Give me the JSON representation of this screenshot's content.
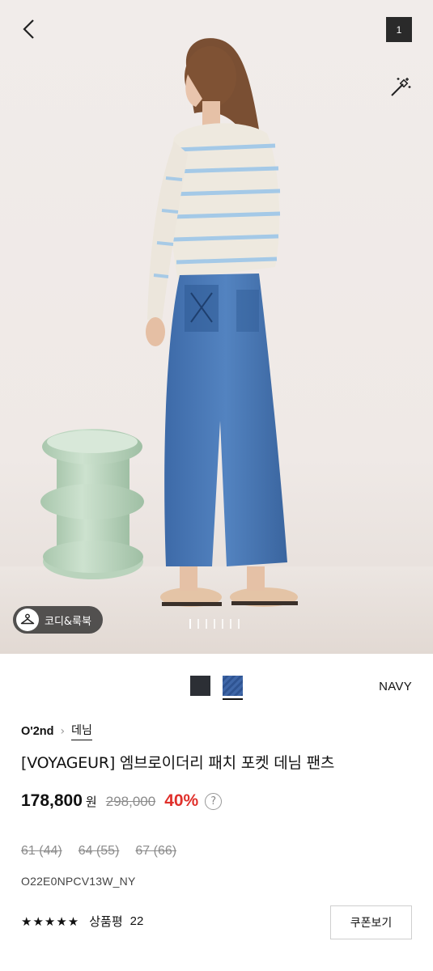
{
  "header": {
    "back_icon": "chevron-left-icon",
    "image_counter": "1",
    "magic_icon": "magic-wand-icon"
  },
  "gallery": {
    "lookbook_label": "코디&룩북",
    "lookbook_icon": "hanger-icon",
    "dot_count": 7,
    "active_dot": 0
  },
  "colors": {
    "swatches": [
      {
        "name": "dark-navy",
        "hex": "#2c2f35"
      },
      {
        "name": "denim",
        "hex": "#3f67a8"
      }
    ],
    "selected_index": 1,
    "selected_name": "NAVY"
  },
  "product": {
    "brand": "O'2nd",
    "category": "데님",
    "title": "[VOYAGEUR] 엠브로이더리 패치 포켓 데님 팬츠",
    "price": "178,800",
    "currency": "원",
    "original_price": "298,000",
    "discount": "40%",
    "sizes": [
      "61 (44)",
      "64 (55)",
      "67 (66)"
    ],
    "sku": "O22E0NPCV13W_NY"
  },
  "review": {
    "stars": "★★★★★",
    "label": "상품평",
    "count": "22"
  },
  "coupon_button": "쿠폰보기",
  "colors_ui": {
    "discount_red": "#e0302b",
    "background": "#ffffff"
  }
}
